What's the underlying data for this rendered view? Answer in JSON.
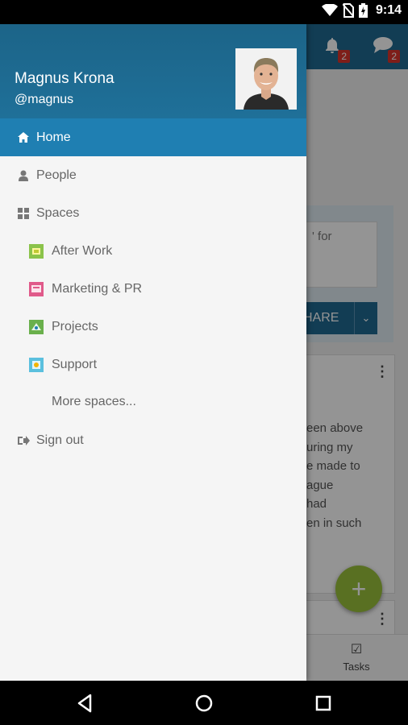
{
  "status_bar": {
    "time": "9:14",
    "icons": [
      "wifi-icon",
      "no-sim-icon",
      "battery-charging-icon"
    ]
  },
  "app": {
    "notifications_badge": "2",
    "messages_badge": "2",
    "status_placeholder_fragment": "' for",
    "share_label": "HARE",
    "post_text": "een above\nuring my\ne made to\nague\nhad\nen in such",
    "tab_tasks_label": "Tasks",
    "fab_label": "+",
    "accent_color": "#1f6a91",
    "fab_color": "#9ac23c"
  },
  "drawer": {
    "user_name": "Magnus Krona",
    "user_handle": "@magnus",
    "items": [
      {
        "label": "Home",
        "icon": "home-icon",
        "active": true
      },
      {
        "label": "People",
        "icon": "person-icon",
        "active": false
      },
      {
        "label": "Spaces",
        "icon": "grid-icon",
        "active": false
      },
      {
        "label": "Sign out",
        "icon": "sign-out-icon",
        "active": false
      }
    ],
    "spaces": [
      {
        "label": "After Work",
        "icon": "after-work-space-icon",
        "color": "#8bc34a"
      },
      {
        "label": "Marketing & PR",
        "icon": "marketing-space-icon",
        "color": "#e05a8a"
      },
      {
        "label": "Projects",
        "icon": "projects-space-icon",
        "color": "#6ab04c"
      },
      {
        "label": "Support",
        "icon": "support-space-icon",
        "color": "#5bc0de"
      }
    ],
    "more_spaces": "More spaces...",
    "header_color": "#1c6488",
    "active_color": "#1f7fb2"
  }
}
